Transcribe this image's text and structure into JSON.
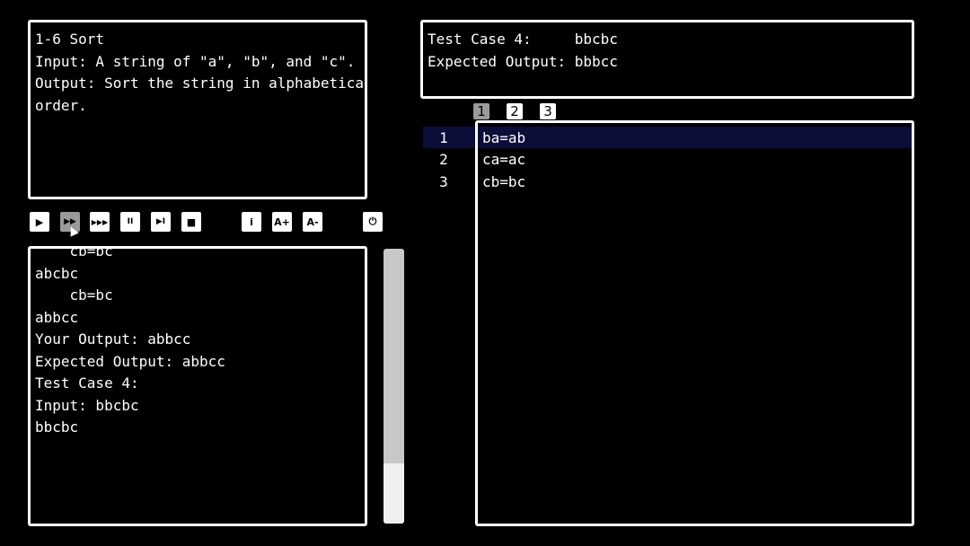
{
  "problem": {
    "lines": [
      "1-6 Sort",
      "Input: A string of \"a\", \"b\", and \"c\".",
      "Output: Sort the string in alphabetical",
      "order."
    ]
  },
  "testcase": {
    "label_line": "Test Case 4:     bbcbc",
    "expected_line": "Expected Output: bbbcc"
  },
  "toolbar": {
    "play": "▶",
    "fast_forward": "▶▶",
    "fastest": "▶▶▶",
    "pause": "II",
    "step": "▶I",
    "stop": "■",
    "info": "i",
    "font_up": "A+",
    "font_down": "A-",
    "power": "⏻"
  },
  "console": {
    "lines": [
      "    cb=bc",
      "abcbc",
      "    cb=bc",
      "abbcc",
      "",
      "Your Output: abbcc",
      "Expected Output: abbcc",
      "",
      "",
      "Test Case 4:",
      "Input: bbcbc",
      "",
      "bbcbc"
    ]
  },
  "tabs": [
    "1",
    "2",
    "3"
  ],
  "editor": {
    "lines": [
      {
        "num": "1",
        "code": "ba=ab"
      },
      {
        "num": "2",
        "code": "ca=ac"
      },
      {
        "num": "3",
        "code": "cb=bc"
      }
    ]
  },
  "scrollbar": {
    "thumb_fraction": 0.22,
    "position": "bottom"
  }
}
